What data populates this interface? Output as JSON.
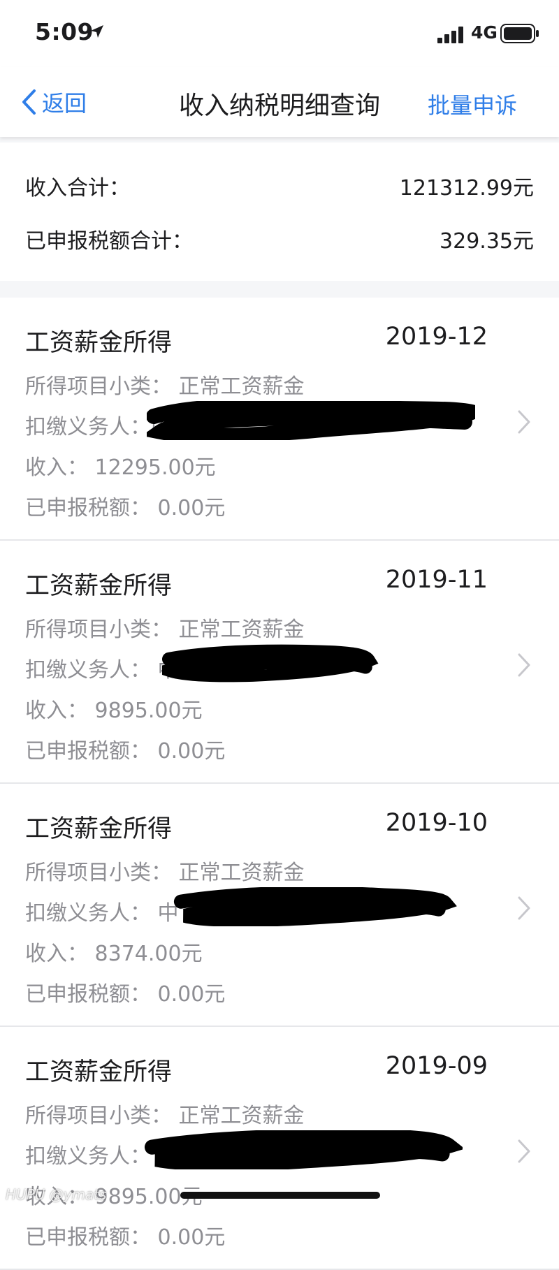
{
  "status_bar": {
    "time": "5:09",
    "network": "4G"
  },
  "nav": {
    "back_label": "返回",
    "title": "收入纳税明细查询",
    "action_label": "批量申诉"
  },
  "summary": {
    "income_label": "收入合计：",
    "income_value": "121312.99元",
    "tax_label": "已申报税额合计：",
    "tax_value": "329.35元"
  },
  "records": [
    {
      "title": "工资薪金所得",
      "period": "2019-12",
      "subcategory": "所得项目小类：  正常工资薪金",
      "withholder": "扣缴义务人：中",
      "income": "收入：  12295.00元",
      "tax": "已申报税额：  0.00元"
    },
    {
      "title": "工资薪金所得",
      "period": "2019-11",
      "subcategory": "所得项目小类：  正常工资薪金",
      "withholder": "扣缴义务人：  中",
      "income": "收入：  9895.00元",
      "tax": "已申报税额：  0.00元"
    },
    {
      "title": "工资薪金所得",
      "period": "2019-10",
      "subcategory": "所得项目小类：  正常工资薪金",
      "withholder": "扣缴义务人：  中",
      "income": "收入：  8374.00元",
      "tax": "已申报税额：  0.00元"
    },
    {
      "title": "工资薪金所得",
      "period": "2019-09",
      "subcategory": "所得项目小类：  正常工资薪金",
      "withholder": "扣缴义务人：",
      "income": "收入：  9895.00元",
      "tax": "已申报税额：  0.00元"
    }
  ],
  "watermark": "HUPU @ymats",
  "colors": {
    "accent": "#2f7ee8",
    "primary_text": "#1c1c1e",
    "secondary_text": "#8e8e93",
    "background": "#f5f6f8"
  },
  "icons": {
    "back": "chevron-left-icon",
    "row": "chevron-right-icon",
    "location": "location-arrow-icon",
    "signal": "signal-icon",
    "battery": "battery-icon"
  }
}
